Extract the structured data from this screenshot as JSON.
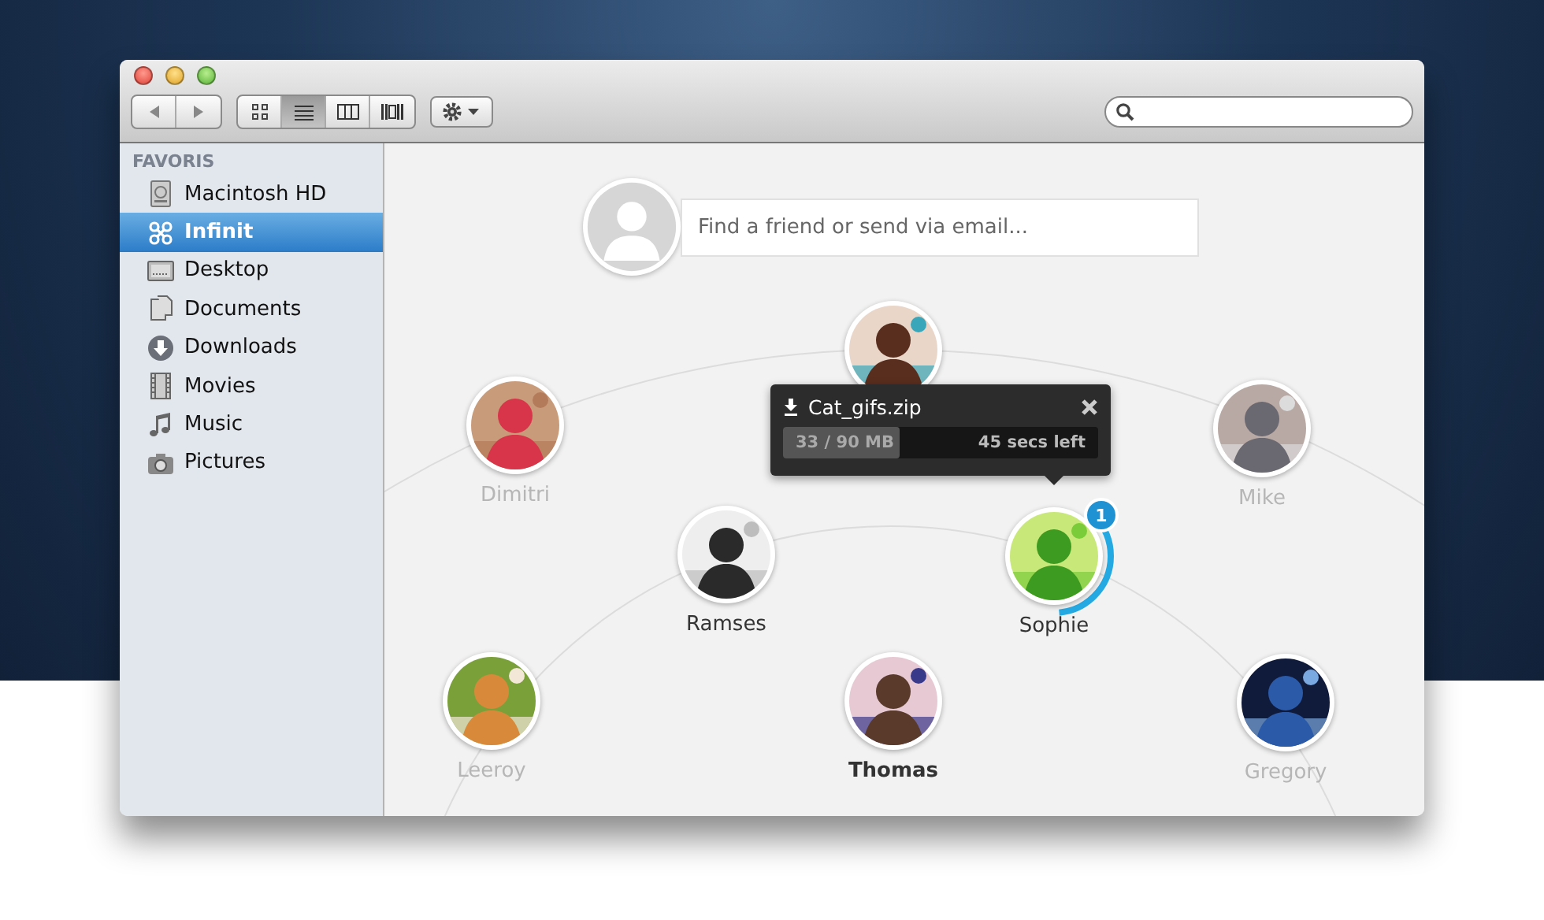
{
  "toolbar": {
    "view_modes": [
      {
        "selected": false
      },
      {
        "selected": true
      },
      {
        "selected": false
      },
      {
        "selected": false
      }
    ]
  },
  "sidebar": {
    "heading": "FAVORIS",
    "items": [
      {
        "label": "Macintosh HD",
        "selected": false
      },
      {
        "label": "Infinit",
        "selected": true
      },
      {
        "label": "Desktop",
        "selected": false
      },
      {
        "label": "Documents",
        "selected": false
      },
      {
        "label": "Downloads",
        "selected": false
      },
      {
        "label": "Movies",
        "selected": false
      },
      {
        "label": "Music",
        "selected": false
      },
      {
        "label": "Pictures",
        "selected": false
      }
    ]
  },
  "friend_search": {
    "placeholder": "Find a friend or send via email..."
  },
  "friends": [
    {
      "kind": "picture"
    },
    {
      "name": "Dimitri",
      "faded": true,
      "bold": false
    },
    {
      "name": "Mike",
      "faded": true,
      "bold": false
    },
    {
      "name": "Ramses",
      "faded": false,
      "bold": false
    },
    {
      "name": "Sophie",
      "faded": false,
      "bold": false,
      "badge": "1",
      "level": 0.36
    },
    {
      "name": "Leeroy",
      "faded": true,
      "bold": false
    },
    {
      "name": "Thomas",
      "faded": false,
      "bold": true
    },
    {
      "name": "Gregory",
      "faded": true,
      "bold": false
    }
  ],
  "transfer": {
    "file": "Cat_gifs.zip",
    "progress": "33 / 90 MB",
    "remaining": "45 secs left",
    "level": 0.37
  }
}
